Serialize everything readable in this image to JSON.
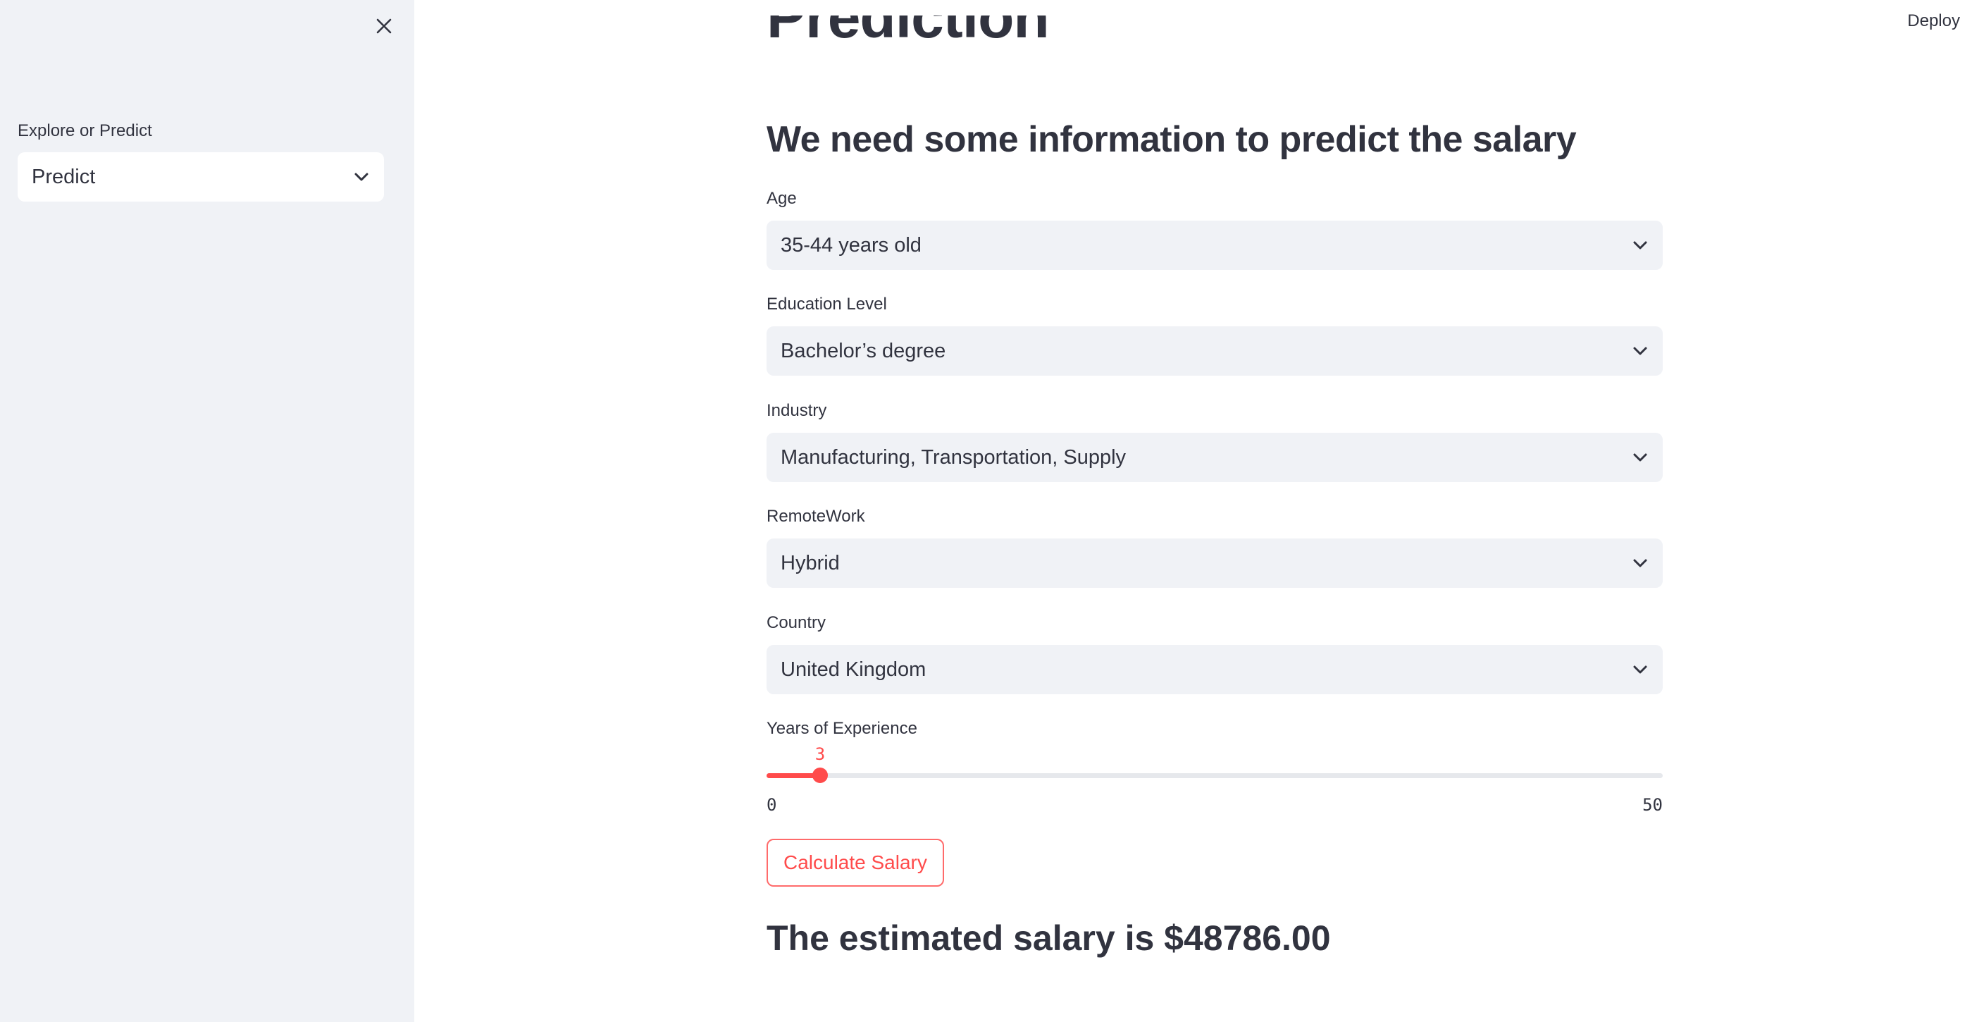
{
  "header": {
    "deploy_label": "Deploy"
  },
  "sidebar": {
    "select_label": "Explore or Predict",
    "select_value": "Predict"
  },
  "main": {
    "title": "Prediction",
    "subtitle": "We need some information to predict the salary",
    "fields": [
      {
        "label": "Age",
        "value": "35-44 years old"
      },
      {
        "label": "Education Level",
        "value": "Bachelor’s degree"
      },
      {
        "label": "Industry",
        "value": "Manufacturing, Transportation, Supply"
      },
      {
        "label": "RemoteWork",
        "value": "Hybrid"
      },
      {
        "label": "Country",
        "value": "United Kingdom"
      }
    ],
    "slider": {
      "label": "Years of Experience",
      "value": 3,
      "min": 0,
      "max": 50,
      "min_label": "0",
      "max_label": "50",
      "value_label": "3"
    },
    "button_label": "Calculate Salary",
    "result": "The estimated salary is $48786.00"
  },
  "colors": {
    "accent": "#ff4b4b",
    "sidebar_bg": "#f0f2f6",
    "text": "#31333f"
  },
  "icons": {
    "close": "close-icon",
    "chevron": "chevron-down-icon"
  }
}
